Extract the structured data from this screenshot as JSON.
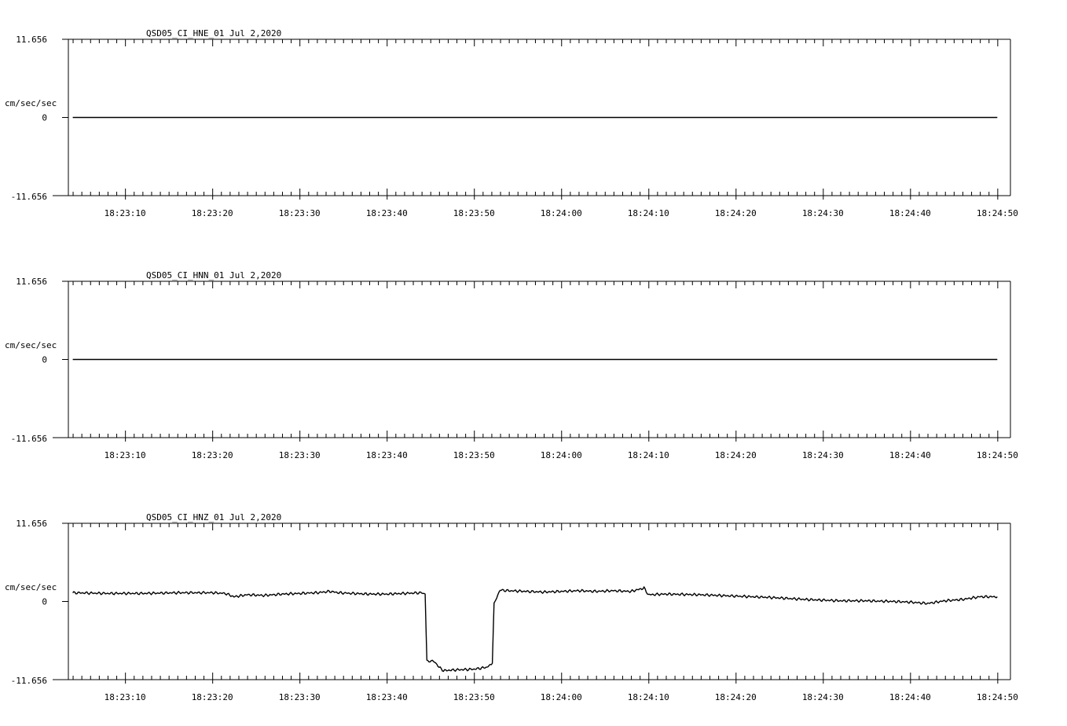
{
  "chart_data": [
    {
      "type": "line",
      "title": "QSD05_CI_HNE_01  Jul 2,2020",
      "ylabel": "cm/sec/sec",
      "ylim": [
        -11.656,
        11.656
      ],
      "ytick_labels": [
        "11.656",
        "0",
        "-11.656"
      ],
      "xtick_labels": [
        "18:23:10",
        "18:23:20",
        "18:23:30",
        "18:23:40",
        "18:23:50",
        "18:24:00",
        "18:24:10",
        "18:24:20",
        "18:24:30",
        "18:24:40",
        "18:24:50"
      ],
      "xlim_seconds_into_minute_18_23": [
        3.5,
        111.5
      ],
      "series": [
        {
          "x": [
            4.0,
            110.0
          ],
          "y": [
            0.0,
            0.0
          ]
        }
      ]
    },
    {
      "type": "line",
      "title": "QSD05_CI_HNN_01  Jul 2,2020",
      "ylabel": "cm/sec/sec",
      "ylim": [
        -11.656,
        11.656
      ],
      "ytick_labels": [
        "11.656",
        "0",
        "-11.656"
      ],
      "xtick_labels": [
        "18:23:10",
        "18:23:20",
        "18:23:30",
        "18:23:40",
        "18:23:50",
        "18:24:00",
        "18:24:10",
        "18:24:20",
        "18:24:30",
        "18:24:40",
        "18:24:50"
      ],
      "xlim_seconds_into_minute_18_23": [
        3.5,
        111.5
      ],
      "series": [
        {
          "x": [
            4.0,
            110.0
          ],
          "y": [
            0.0,
            0.0
          ]
        }
      ]
    },
    {
      "type": "line",
      "title": "QSD05_CI_HNZ_01  Jul 2,2020",
      "ylabel": "cm/sec/sec",
      "ylim": [
        -11.656,
        11.656
      ],
      "ytick_labels": [
        "11.656",
        "0",
        "-11.656"
      ],
      "xtick_labels": [
        "18:23:10",
        "18:23:20",
        "18:23:30",
        "18:23:40",
        "18:23:50",
        "18:24:00",
        "18:24:10",
        "18:24:20",
        "18:24:30",
        "18:24:40",
        "18:24:50"
      ],
      "xlim_seconds_into_minute_18_23": [
        3.5,
        111.5
      ],
      "series": [
        {
          "x": [
            4.0,
            8.0,
            12.0,
            16.0,
            20.0,
            21.5,
            22.5,
            24.0,
            26.0,
            28.0,
            30.0,
            32.0,
            33.5,
            34.5,
            36.0,
            38.0,
            40.0,
            42.0,
            44.0,
            44.4,
            44.6,
            45.5,
            46.0,
            46.5,
            48.0,
            50.0,
            51.5,
            52.1,
            52.3,
            52.6,
            53.0,
            54.0,
            56.0,
            58.0,
            60.0,
            62.0,
            64.0,
            66.0,
            68.0,
            69.5,
            70.0,
            72.0,
            76.0,
            80.0,
            84.0,
            88.0,
            92.0,
            95.0,
            98.0,
            100.0,
            102.0,
            104.0,
            106.0,
            108.0,
            110.0
          ],
          "y": [
            1.3,
            1.2,
            1.2,
            1.3,
            1.3,
            1.2,
            0.7,
            1.0,
            0.9,
            1.1,
            1.2,
            1.3,
            1.5,
            1.3,
            1.2,
            1.1,
            1.1,
            1.2,
            1.3,
            1.0,
            -8.8,
            -9.0,
            -9.8,
            -10.3,
            -10.2,
            -10.1,
            -9.8,
            -9.2,
            -0.2,
            0.6,
            1.7,
            1.6,
            1.5,
            1.4,
            1.5,
            1.6,
            1.5,
            1.6,
            1.5,
            2.0,
            1.0,
            1.1,
            1.0,
            0.8,
            0.6,
            0.3,
            0.1,
            0.1,
            0.0,
            -0.1,
            -0.3,
            0.1,
            0.3,
            0.7,
            0.7
          ]
        }
      ]
    }
  ]
}
